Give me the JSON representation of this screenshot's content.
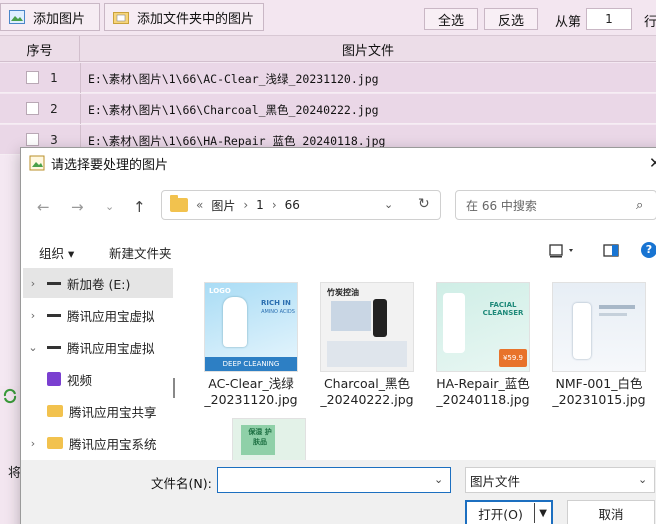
{
  "toolbar": {
    "add_image": "添加图片",
    "add_folder": "添加文件夹中的图片",
    "select_all": "全选",
    "invert": "反选",
    "from_label": "从第",
    "from_value": "1",
    "row_label": "行"
  },
  "grid": {
    "col_index": "序号",
    "col_file": "图片文件",
    "rows": [
      {
        "index": "1",
        "path": "E:\\素材\\图片\\1\\66\\AC-Clear_浅绿_20231120.jpg"
      },
      {
        "index": "2",
        "path": "E:\\素材\\图片\\1\\66\\Charcoal_黑色_20240222.jpg"
      },
      {
        "index": "3",
        "path": "E:\\素材\\图片\\1\\66\\HA-Repair_蓝色_20240118.jpg"
      }
    ]
  },
  "app_bottom": {
    "text": "将"
  },
  "dialog": {
    "title": "请选择要处理的图片",
    "breadcrumb": {
      "prefix": "«",
      "items": [
        "图片",
        "1",
        "66"
      ]
    },
    "search_placeholder": "在 66 中搜索",
    "organize": "组织 ▾",
    "new_folder": "新建文件夹",
    "sidebar": [
      {
        "label": "新加卷 (E:)",
        "type": "drive"
      },
      {
        "label": "腾讯应用宝虚拟",
        "type": "drive"
      },
      {
        "label": "腾讯应用宝虚拟",
        "type": "drive"
      },
      {
        "label": "视频",
        "type": "video"
      },
      {
        "label": "腾讯应用宝共享",
        "type": "folder"
      },
      {
        "label": "腾讯应用宝系统",
        "type": "folder"
      }
    ],
    "files": [
      {
        "line1": "AC-Clear_浅绿",
        "line2": "_20231120.jpg"
      },
      {
        "line1": "Charcoal_黑色",
        "line2": "_20240222.jpg"
      },
      {
        "line1": "HA-Repair_蓝色",
        "line2": "_20240118.jpg"
      },
      {
        "line1": "NMF-001_白色",
        "line2": "_20231015.jpg"
      }
    ],
    "thumb_text": {
      "t1_logo": "LOGO",
      "t1_rich": "RICH IN",
      "t1_amino": "AMINO ACIDS",
      "t1_deep": "DEEP CLEANING",
      "t2_head": "竹炭控油",
      "t3_head": "FACIAL CLEANSER",
      "t3_price": "¥59.9",
      "t5_head": "保湿 护肤品"
    },
    "filename_label": "文件名(N):",
    "filename_value": "",
    "filter": "图片文件",
    "open": "打开(O)",
    "cancel": "取消"
  }
}
